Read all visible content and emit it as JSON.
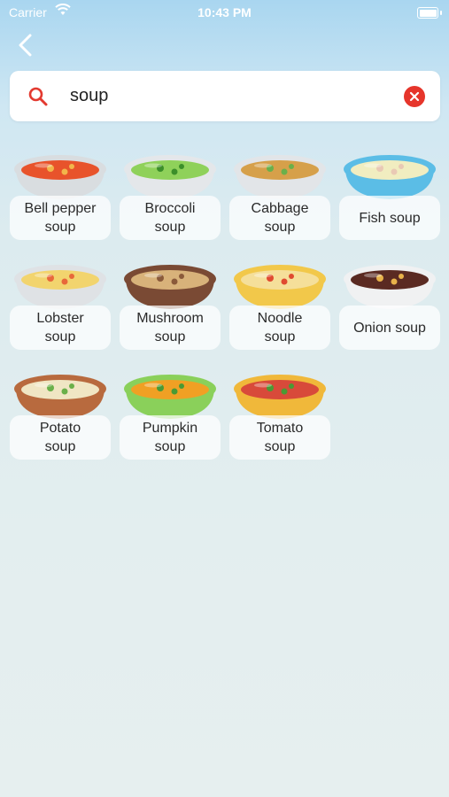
{
  "status_bar": {
    "carrier": "Carrier",
    "time": "10:43 PM"
  },
  "search": {
    "value": "soup",
    "placeholder": ""
  },
  "items": [
    {
      "line1": "Bell pepper",
      "line2": "soup",
      "rim": "#d9dde0",
      "liquid": "#e8532b",
      "garnish": "#f2b64a"
    },
    {
      "line1": "Broccoli",
      "line2": "soup",
      "rim": "#e4e7ea",
      "liquid": "#8fd15a",
      "garnish": "#3c8f2a"
    },
    {
      "line1": "Cabbage",
      "line2": "soup",
      "rim": "#e2e5e8",
      "liquid": "#d6a04a",
      "garnish": "#6ab04a"
    },
    {
      "line1": "Fish soup",
      "line2": "",
      "rim": "#5bbde6",
      "liquid": "#f1edc0",
      "garnish": "#e9c9b4"
    },
    {
      "line1": "Lobster",
      "line2": "soup",
      "rim": "#dfe2e5",
      "liquid": "#f2d46e",
      "garnish": "#e8683a"
    },
    {
      "line1": "Mushroom",
      "line2": "soup",
      "rim": "#7a4a34",
      "liquid": "#d8b27a",
      "garnish": "#8a5a3a"
    },
    {
      "line1": "Noodle",
      "line2": "soup",
      "rim": "#f2c84a",
      "liquid": "#f5df9a",
      "garnish": "#e04a30"
    },
    {
      "line1": "Onion soup",
      "line2": "",
      "rim": "#f0f1f2",
      "liquid": "#5a2a22",
      "garnish": "#e8b24a"
    },
    {
      "line1": "Potato",
      "line2": "soup",
      "rim": "#b86a3e",
      "liquid": "#f0e6c4",
      "garnish": "#6ab04a"
    },
    {
      "line1": "Pumpkin",
      "line2": "soup",
      "rim": "#8ad05a",
      "liquid": "#f0a024",
      "garnish": "#4a9a34"
    },
    {
      "line1": "Tomato",
      "line2": "soup",
      "rim": "#f0b83a",
      "liquid": "#d84a3a",
      "garnish": "#4a9a34"
    }
  ]
}
